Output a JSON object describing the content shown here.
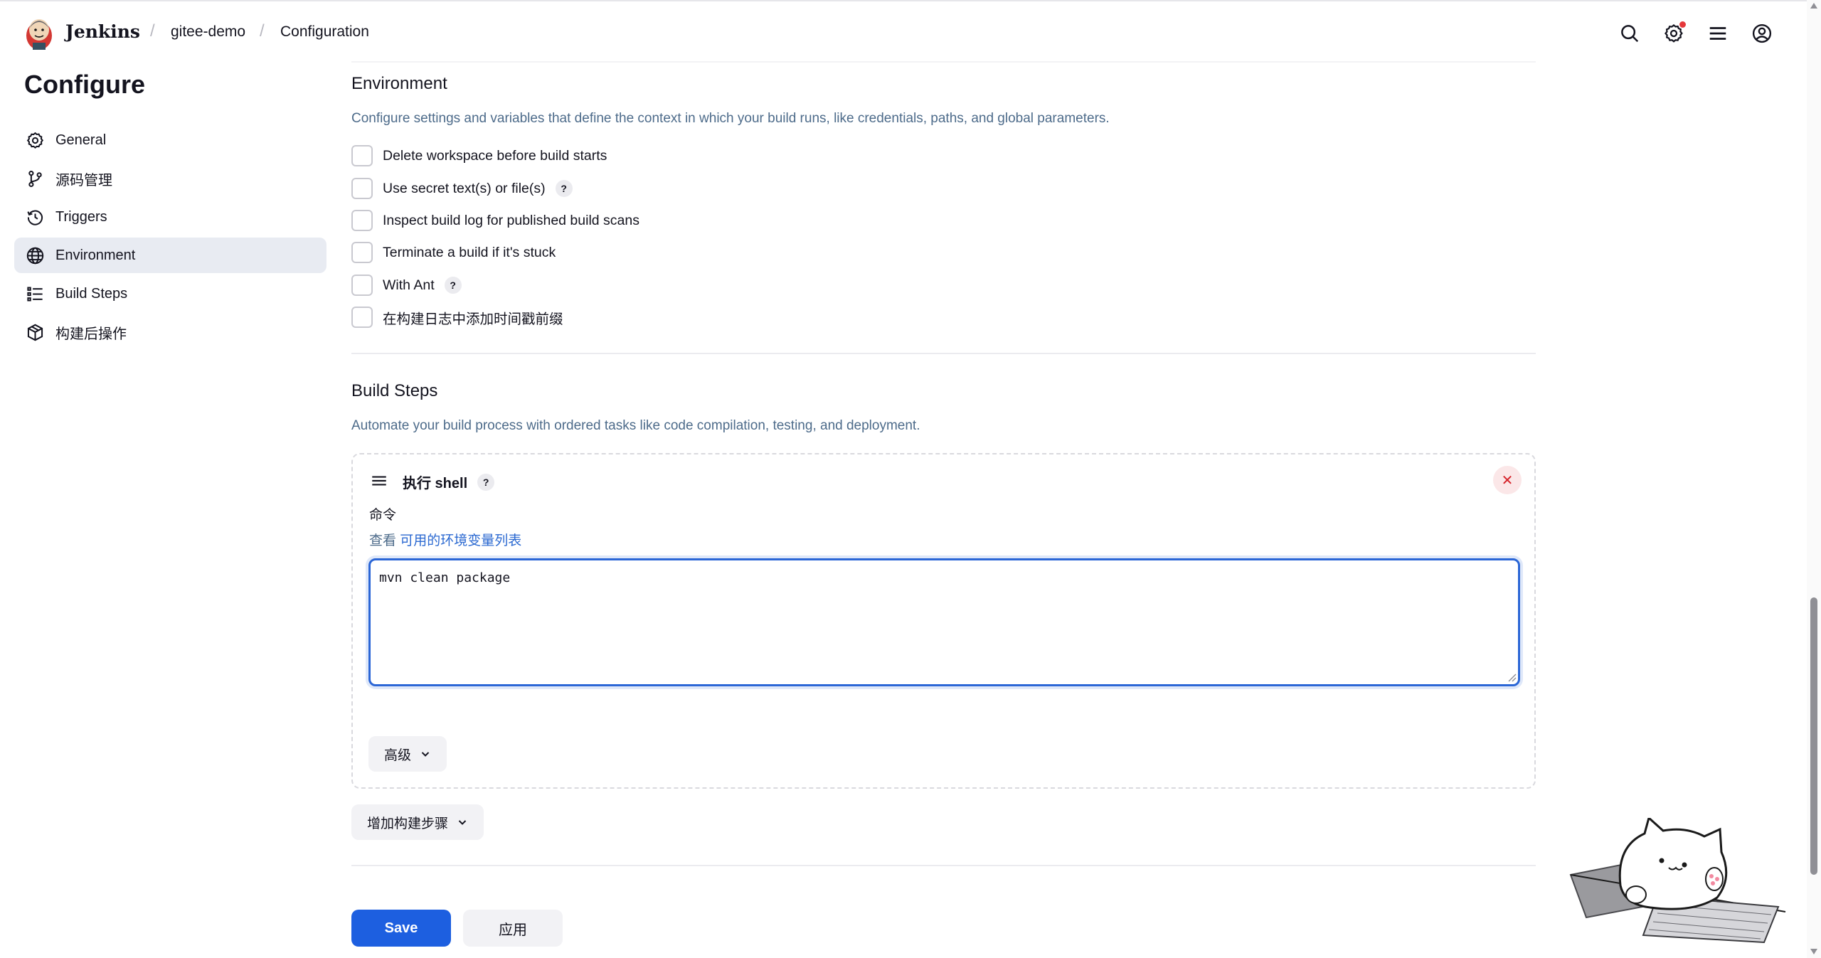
{
  "header": {
    "brand": "Jenkins",
    "breadcrumb": [
      "gitee-demo",
      "Configuration"
    ],
    "icons": [
      "search-icon",
      "settings-icon",
      "menu-icon",
      "account-icon"
    ]
  },
  "sidebar": {
    "title": "Configure",
    "items": [
      {
        "label": "General",
        "icon": "gear-icon"
      },
      {
        "label": "源码管理",
        "icon": "branch-icon"
      },
      {
        "label": "Triggers",
        "icon": "clock-icon"
      },
      {
        "label": "Environment",
        "icon": "globe-icon",
        "active": true
      },
      {
        "label": "Build Steps",
        "icon": "list-icon"
      },
      {
        "label": "构建后操作",
        "icon": "package-icon"
      }
    ]
  },
  "environment": {
    "title": "Environment",
    "description": "Configure settings and variables that define the context in which your build runs, like credentials, paths, and global parameters.",
    "options": [
      {
        "label": "Delete workspace before build starts",
        "checked": false,
        "help": false
      },
      {
        "label": "Use secret text(s) or file(s)",
        "checked": false,
        "help": true
      },
      {
        "label": "Inspect build log for published build scans",
        "checked": false,
        "help": false
      },
      {
        "label": "Terminate a build if it's stuck",
        "checked": false,
        "help": false
      },
      {
        "label": "With Ant",
        "checked": false,
        "help": true
      },
      {
        "label": "在构建日志中添加时间戳前缀",
        "checked": false,
        "help": false
      }
    ]
  },
  "build_steps": {
    "title": "Build Steps",
    "description": "Automate your build process with ordered tasks like code compilation, testing, and deployment.",
    "step": {
      "title": "执行 shell",
      "help_mark": "?",
      "close_mark": "✕",
      "field_label": "命令",
      "link_prefix": "查看 ",
      "link_text": "可用的环境变量列表",
      "command": "mvn clean package",
      "advanced_label": "高级"
    },
    "add_step_label": "增加构建步骤"
  },
  "footer": {
    "save_label": "Save",
    "apply_label": "应用"
  }
}
